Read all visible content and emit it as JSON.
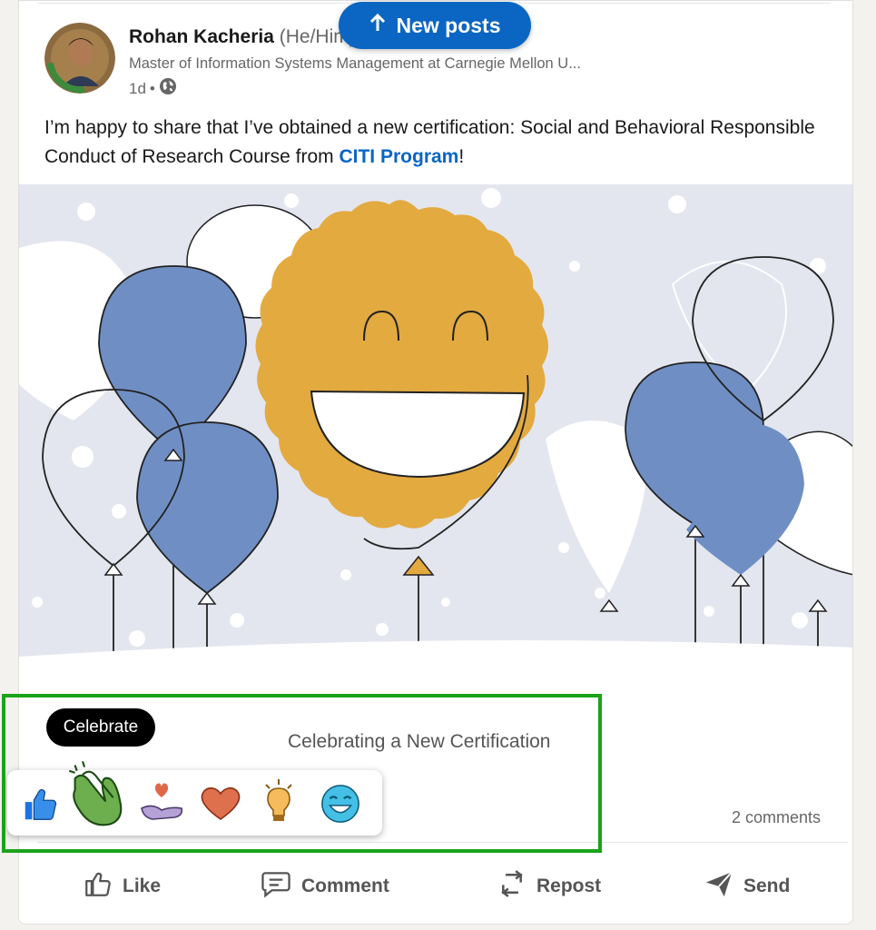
{
  "new_posts_label": "New posts",
  "author": {
    "name": "Rohan Kacheria",
    "pronouns": "(He/Him)",
    "headline": "Master of Information Systems Management at Carnegie Mellon U...",
    "time": "1d",
    "avatar_badge": "#OPENTOWORK"
  },
  "post": {
    "text_before": "I’m happy to share that I’ve obtained a new certification: Social and Behavioral Responsible Conduct of Research Course from ",
    "link_text": "CITI Program",
    "text_after": "!"
  },
  "document_title": "Celebrating a New Certification",
  "comments_count": "2 comments",
  "tooltip": "Celebrate",
  "reactions": [
    "like-icon",
    "celebrate-icon",
    "support-icon",
    "love-icon",
    "insightful-icon",
    "funny-icon"
  ],
  "actions": {
    "like": "Like",
    "comment": "Comment",
    "repost": "Repost",
    "send": "Send"
  },
  "colors": {
    "brand": "#0a66c2",
    "highlight": "#1aa31a",
    "balloon_blue": "#6f8fc4",
    "badge_gold": "#e3aa40",
    "banner_bg": "#e3e6ee"
  }
}
